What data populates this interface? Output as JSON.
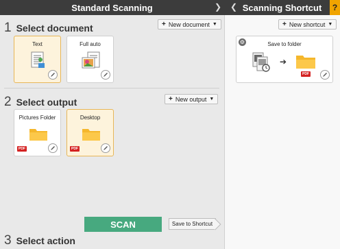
{
  "left_header": {
    "title": "Standard Scanning",
    "next_icon": "chevron-right-icon"
  },
  "right_header": {
    "title": "Scanning Shortcut",
    "back_icon": "chevron-left-icon",
    "help_label": "?"
  },
  "document_section": {
    "number": "1",
    "label": "Select document",
    "new_button": "New document",
    "cards": [
      {
        "label": "Text",
        "icon": "text-document-icon",
        "selected": true
      },
      {
        "label": "Full auto",
        "icon": "photo-document-icon",
        "selected": false
      }
    ]
  },
  "output_section": {
    "number": "2",
    "label": "Select output",
    "new_button": "New output",
    "cards": [
      {
        "label": "Pictures Folder",
        "icon": "folder-icon",
        "badge": "PDF",
        "selected": false
      },
      {
        "label": "Desktop",
        "icon": "folder-icon",
        "badge": "PDF",
        "selected": true
      }
    ]
  },
  "action_section": {
    "number": "3",
    "label": "Select action",
    "scan_button": "SCAN",
    "save_shortcut_button": "Save to Shortcut"
  },
  "shortcut_panel": {
    "new_button": "New shortcut",
    "cards": [
      {
        "label": "Save to folder",
        "badge": "PDF",
        "icon": "gear-icon"
      }
    ]
  },
  "colors": {
    "header_bg": "#3c3c3c",
    "help_bg": "#f0a400",
    "scan_green": "#47a97f",
    "selected_card_bg": "#fdf3dc",
    "selected_card_border": "#e7b657",
    "pdf_red": "#d42121",
    "folder_yellow": "#f5b72c"
  }
}
